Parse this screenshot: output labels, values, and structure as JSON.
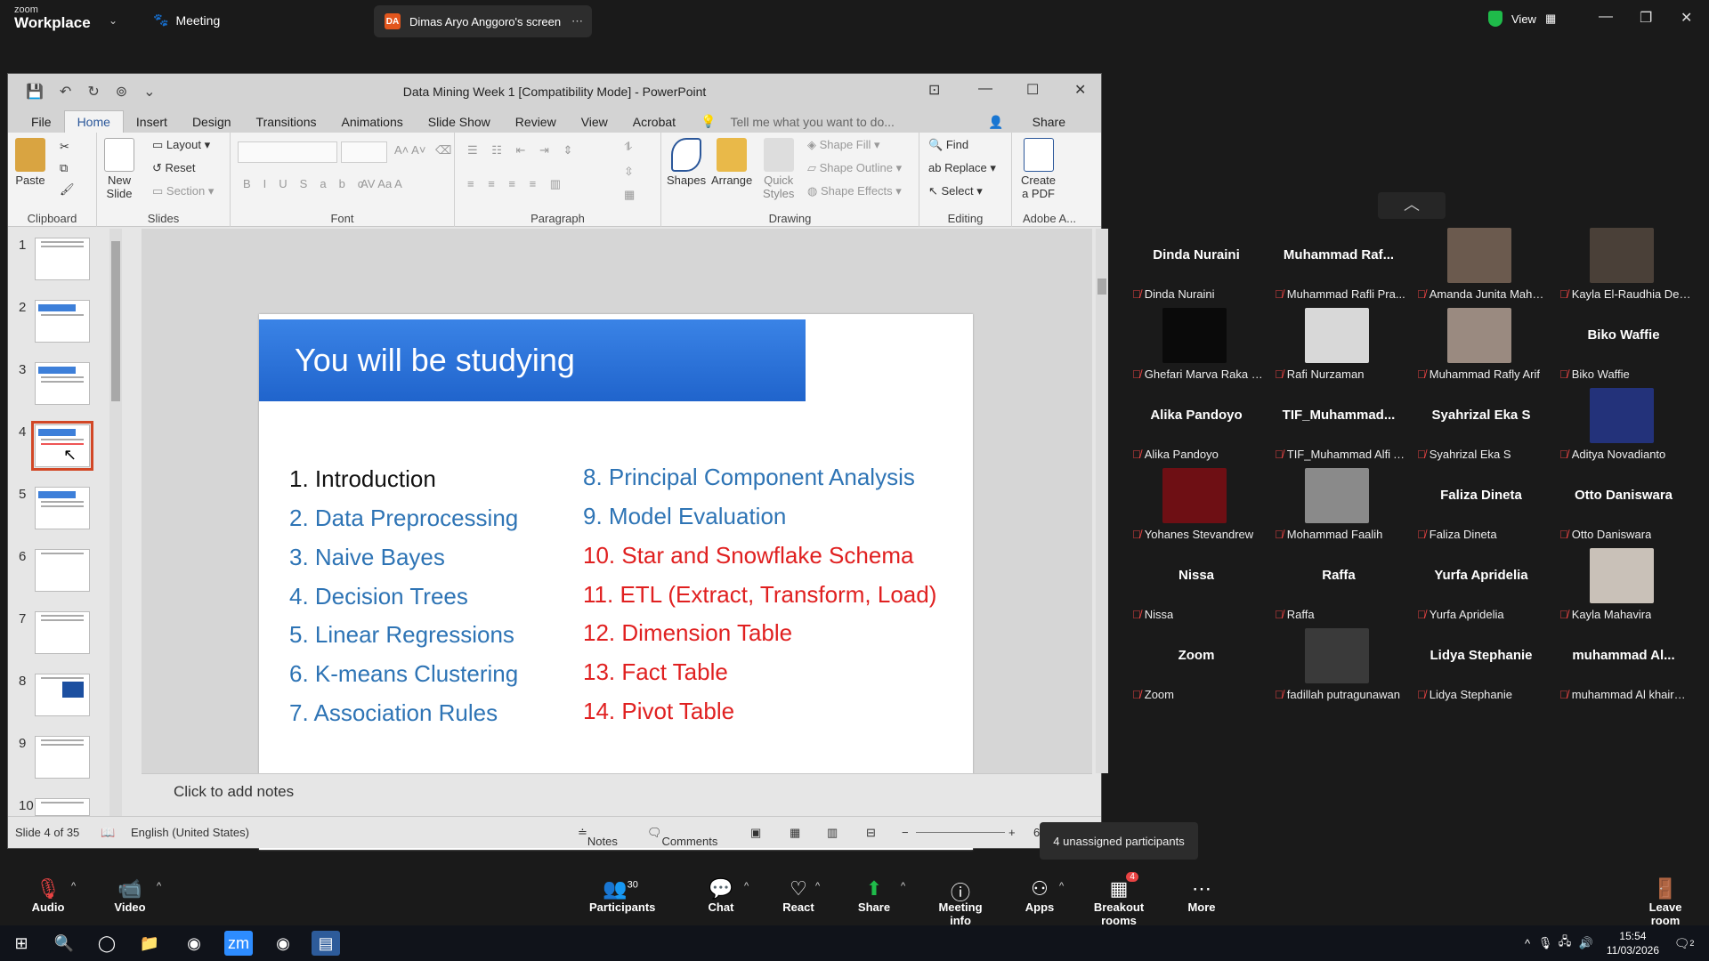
{
  "topbar": {
    "logo_small": "zoom",
    "logo_big": "Workplace",
    "meeting_label": "Meeting",
    "share_tab_initials": "DA",
    "share_tab_label": "Dimas Aryo Anggoro's screen",
    "view_label": "View"
  },
  "ppt": {
    "title": "Data Mining Week 1 [Compatibility Mode] - PowerPoint",
    "tabs": [
      "File",
      "Home",
      "Insert",
      "Design",
      "Transitions",
      "Animations",
      "Slide Show",
      "Review",
      "View",
      "Acrobat"
    ],
    "tell_me": "Tell me what you want to do...",
    "share": "Share",
    "ribbon": {
      "paste": "Paste",
      "clipboard": "Clipboard",
      "new_slide_line1": "New",
      "new_slide_line2": "Slide",
      "layout": "Layout",
      "reset": "Reset",
      "section": "Section",
      "slides": "Slides",
      "font": "Font",
      "paragraph": "Paragraph",
      "shapes": "Shapes",
      "arrange": "Arrange",
      "quick_styles_line1": "Quick",
      "quick_styles_line2": "Styles",
      "shape_fill": "Shape Fill",
      "shape_outline": "Shape Outline",
      "shape_effects": "Shape Effects",
      "drawing": "Drawing",
      "find": "Find",
      "replace": "Replace",
      "select": "Select",
      "editing": "Editing",
      "create_pdf_line1": "Create",
      "create_pdf_line2": "a PDF",
      "adobe": "Adobe A..."
    },
    "thumbnails": [
      "1",
      "2",
      "3",
      "4",
      "5",
      "6",
      "7",
      "8",
      "9",
      "10"
    ],
    "slide": {
      "heading": "You will be studying",
      "left_items": [
        "1. Introduction",
        "2. Data Preprocessing",
        "3. Naive Bayes",
        "4. Decision Trees",
        "5. Linear Regressions",
        "6. K-means Clustering",
        "7. Association Rules"
      ],
      "right_items": [
        "8. Principal Component Analysis",
        "9. Model Evaluation",
        "10. Star and Snowflake Schema",
        "11. ETL (Extract, Transform, Load)",
        "12. Dimension Table",
        "13. Fact Table",
        "14. Pivot Table"
      ]
    },
    "notes_placeholder": "Click to add notes",
    "status": {
      "slide_of": "Slide 4 of 35",
      "language": "English (United States)",
      "notes": "Notes",
      "comments": "Comments",
      "zoom_prefix": "6"
    }
  },
  "participants": [
    {
      "name": "Dinda Nuraini",
      "label": "Dinda Nuraini",
      "video": false
    },
    {
      "name": "Muhammad  Raf...",
      "label": "Muhammad Rafli Pra...",
      "video": false
    },
    {
      "name": "",
      "label": "Amanda Junita Maha ...",
      "video": true,
      "color": "#6b5a4e"
    },
    {
      "name": "",
      "label": "Kayla El-Raudhia De ...",
      "video": true,
      "color": "#4a4038"
    },
    {
      "name": "",
      "label": "Ghefari Marva Raka P...",
      "video": true,
      "color": "#0a0a0a"
    },
    {
      "name": "",
      "label": "Rafi Nurzaman",
      "video": true,
      "color": "#d8d8d8"
    },
    {
      "name": "",
      "label": "Muhammad Rafly Arif",
      "video": true,
      "color": "#9a8a80"
    },
    {
      "name": "Biko Waffie",
      "label": "Biko Waffie",
      "video": false
    },
    {
      "name": "Alika Pandoyo",
      "label": "Alika Pandoyo",
      "video": false
    },
    {
      "name": "TIF_Muhammad...",
      "label": "TIF_Muhammad Alfi A...",
      "video": false
    },
    {
      "name": "Syahrizal Eka S",
      "label": "Syahrizal Eka S",
      "video": false
    },
    {
      "name": "",
      "label": "Aditya Novadianto",
      "video": true,
      "color": "#23327a"
    },
    {
      "name": "",
      "label": "Yohanes Stevandrew",
      "video": true,
      "color": "#6e0f14"
    },
    {
      "name": "",
      "label": "Mohammad Faalih",
      "video": true,
      "color": "#8a8a8a"
    },
    {
      "name": "Faliza Dineta",
      "label": "Faliza Dineta",
      "video": false
    },
    {
      "name": "Otto Daniswara",
      "label": "Otto Daniswara",
      "video": false
    },
    {
      "name": "Nissa",
      "label": "Nissa",
      "video": false
    },
    {
      "name": "Raffa",
      "label": "Raffa",
      "video": false
    },
    {
      "name": "Yurfa Apridelia",
      "label": "Yurfa Apridelia",
      "video": false
    },
    {
      "name": "",
      "label": "Kayla Mahavira",
      "video": true,
      "color": "#c9c1b8"
    },
    {
      "name": "Zoom",
      "label": "Zoom",
      "video": false
    },
    {
      "name": "",
      "label": "fadillah putragunawan",
      "video": true,
      "color": "#3a3a3a"
    },
    {
      "name": "Lidya Stephanie",
      "label": "Lidya Stephanie",
      "video": false
    },
    {
      "name": "muhammad  Al...",
      "label": "muhammad Al khairul...",
      "video": false
    }
  ],
  "tooltip": "4 unassigned participants",
  "bottombar": {
    "audio": "Audio",
    "video": "Video",
    "participants": "Participants",
    "participants_count": "30",
    "chat": "Chat",
    "react": "React",
    "share": "Share",
    "meeting_info": "Meeting info",
    "apps": "Apps",
    "breakout": "Breakout rooms",
    "breakout_badge": "4",
    "more": "More",
    "leave": "Leave room"
  },
  "taskbar": {
    "time": "15:54",
    "date": "11/03/2026",
    "notif_count": "2"
  },
  "colors": {
    "slide_header_blue": "#2f74dd",
    "item_blue": "#2e74b5",
    "item_red": "#e02020",
    "share_green": "#1fbb4a",
    "muted_red": "#e84343"
  }
}
